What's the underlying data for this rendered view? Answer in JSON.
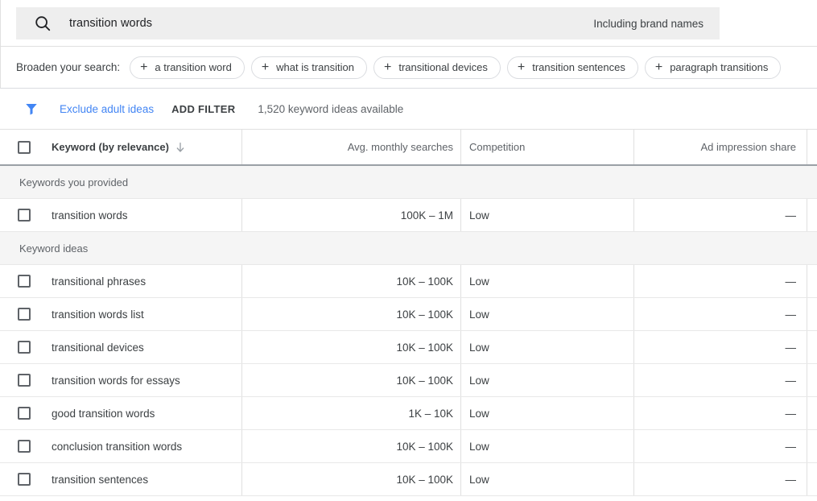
{
  "search": {
    "icon": "search-icon",
    "value": "transition words",
    "brand_names_label": "Including brand names"
  },
  "broaden": {
    "label": "Broaden your search:",
    "plus": "+",
    "chips": [
      {
        "label": "a transition word"
      },
      {
        "label": "what is transition"
      },
      {
        "label": "transitional devices"
      },
      {
        "label": "transition sentences"
      },
      {
        "label": "paragraph transitions"
      }
    ]
  },
  "filter_bar": {
    "funnel_icon": "filter-funnel-icon",
    "exclude_adult": "Exclude adult ideas",
    "add_filter": "ADD FILTER",
    "ideas_available": "1,520 keyword ideas available",
    "accent_color": "#4285f4"
  },
  "table": {
    "columns": [
      {
        "key": "keyword",
        "label": "Keyword (by relevance)",
        "sort_icon": "arrow-down-icon"
      },
      {
        "key": "searches",
        "label": "Avg. monthly searches"
      },
      {
        "key": "competition",
        "label": "Competition"
      },
      {
        "key": "ad_impression_share",
        "label": "Ad impression share"
      }
    ],
    "groups": [
      {
        "title": "Keywords you provided",
        "rows": [
          {
            "keyword": "transition words",
            "searches": "100K – 1M",
            "competition": "Low",
            "ad_impression_share": "—"
          }
        ]
      },
      {
        "title": "Keyword ideas",
        "rows": [
          {
            "keyword": "transitional phrases",
            "searches": "10K – 100K",
            "competition": "Low",
            "ad_impression_share": "—"
          },
          {
            "keyword": "transition words list",
            "searches": "10K – 100K",
            "competition": "Low",
            "ad_impression_share": "—"
          },
          {
            "keyword": "transitional devices",
            "searches": "10K – 100K",
            "competition": "Low",
            "ad_impression_share": "—"
          },
          {
            "keyword": "transition words for essays",
            "searches": "10K – 100K",
            "competition": "Low",
            "ad_impression_share": "—"
          },
          {
            "keyword": "good transition words",
            "searches": "1K – 10K",
            "competition": "Low",
            "ad_impression_share": "—"
          },
          {
            "keyword": "conclusion transition words",
            "searches": "10K – 100K",
            "competition": "Low",
            "ad_impression_share": "—"
          },
          {
            "keyword": "transition sentences",
            "searches": "10K – 100K",
            "competition": "Low",
            "ad_impression_share": "—"
          }
        ]
      }
    ]
  }
}
